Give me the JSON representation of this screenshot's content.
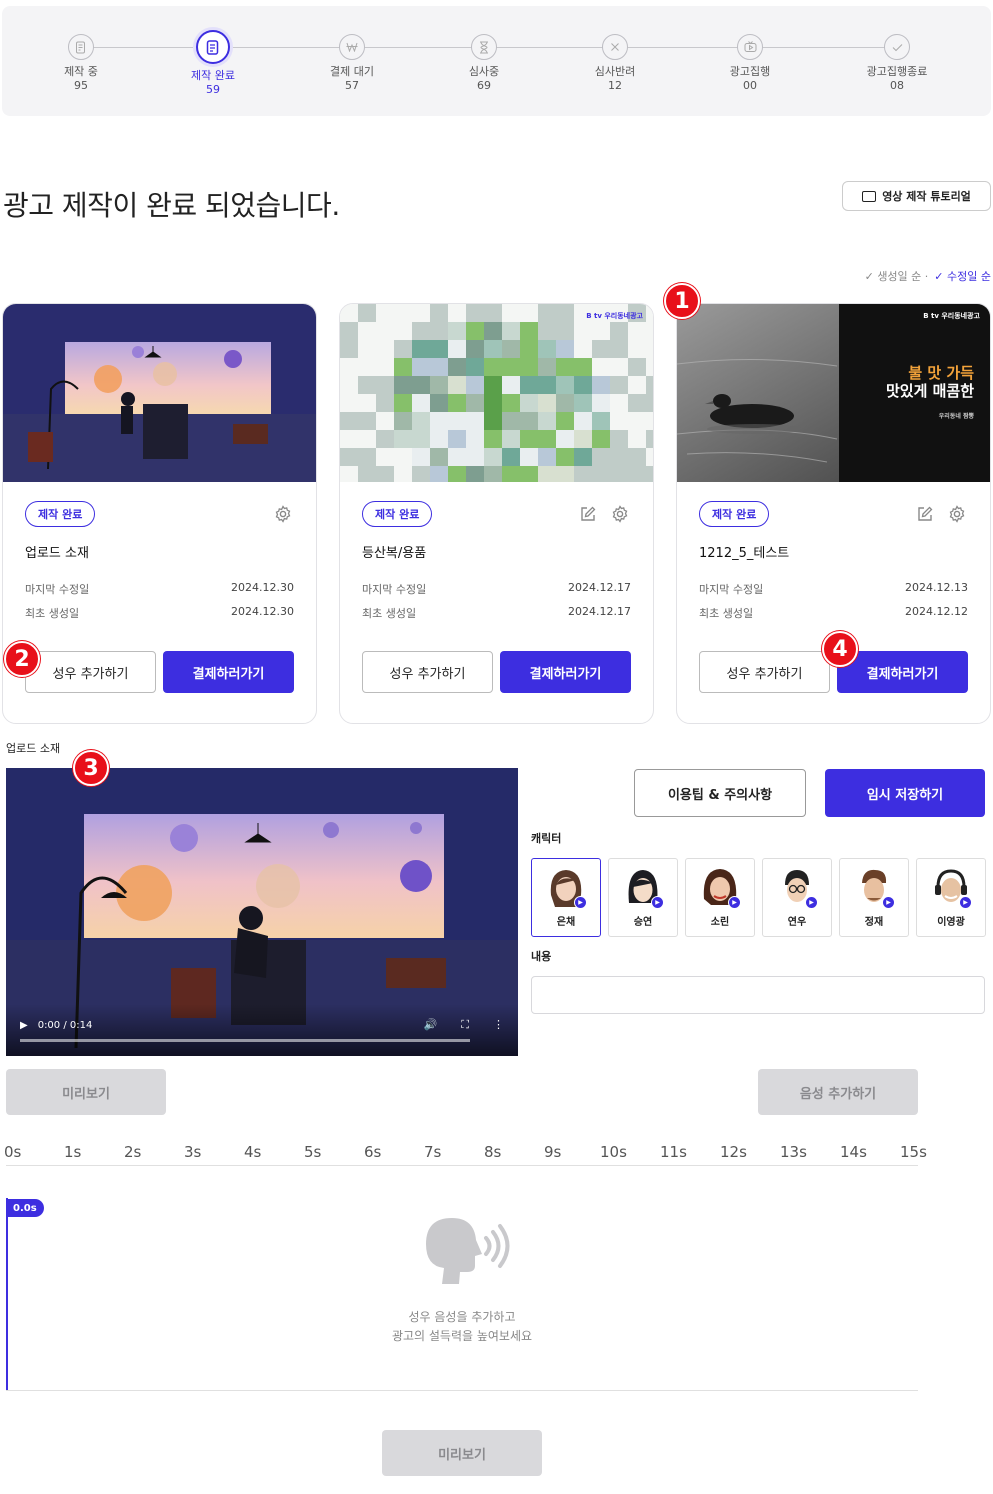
{
  "steps": [
    {
      "label": "제작 중",
      "count": "95",
      "icon": "draft-document-icon"
    },
    {
      "label": "제작 완료",
      "count": "59",
      "icon": "completed-document-icon"
    },
    {
      "label": "결제 대기",
      "count": "57",
      "icon": "won-currency-icon"
    },
    {
      "label": "심사중",
      "count": "69",
      "icon": "hourglass-icon"
    },
    {
      "label": "심사반려",
      "count": "12",
      "icon": "x-circle-icon"
    },
    {
      "label": "광고집행",
      "count": "00",
      "icon": "tv-play-icon"
    },
    {
      "label": "광고집행종료",
      "count": "08",
      "icon": "check-circle-icon"
    }
  ],
  "page_title": "광고 제작이 완료 되었습니다.",
  "tutorial_label": "영상 제작 튜토리얼",
  "sort": {
    "option1": "생성일 순",
    "option2": "수정일 순",
    "active": "수정일 순"
  },
  "cards": [
    {
      "badge": "제작 완료",
      "title": "업로드 소재",
      "modified_label": "마지막 수정일",
      "modified_value": "2024.12.30",
      "created_label": "최초 생성일",
      "created_value": "2024.12.30",
      "voice_button": "성우 추가하기",
      "pay_button": "결제하러가기"
    },
    {
      "badge": "제작 완료",
      "title": "등산복/용품",
      "modified_label": "마지막 수정일",
      "modified_value": "2024.12.17",
      "created_label": "최초 생성일",
      "created_value": "2024.12.17",
      "voice_button": "성우 추가하기",
      "pay_button": "결제하러가기",
      "brand_tag": "B tv 우리동네광고"
    },
    {
      "badge": "제작 완료",
      "title": "1212_5_테스트",
      "modified_label": "마지막 수정일",
      "modified_value": "2024.12.13",
      "created_label": "최초 생성일",
      "created_value": "2024.12.12",
      "voice_button": "성우 추가하기",
      "pay_button": "결제하러가기",
      "brand_tag": "B tv 우리동네광고",
      "overlay_line1": "불 맛 가득",
      "overlay_line2": "맛있게 매콤한",
      "overlay_small": "우리동네 짬뽕"
    }
  ],
  "markers": [
    "1",
    "2",
    "3",
    "4"
  ],
  "editor": {
    "section_label": "업로드 소재",
    "video_time": "0:00 / 0:14",
    "video_progress": 0,
    "tip_button": "이용팁 & 주의사항",
    "save_button": "임시 저장하기",
    "character_label": "캐릭터",
    "characters": [
      {
        "name": "은채",
        "selected": true
      },
      {
        "name": "승연",
        "selected": false
      },
      {
        "name": "소린",
        "selected": false
      },
      {
        "name": "연우",
        "selected": false
      },
      {
        "name": "정재",
        "selected": false
      },
      {
        "name": "이영광",
        "selected": false
      }
    ],
    "content_label": "내용",
    "content_value": "",
    "preview_button": "미리보기",
    "add_voice_button": "음성 추가하기"
  },
  "timeline": {
    "ticks": [
      "0s",
      "1s",
      "2s",
      "3s",
      "4s",
      "5s",
      "6s",
      "7s",
      "8s",
      "9s",
      "10s",
      "11s",
      "12s",
      "13s",
      "14s",
      "15s"
    ],
    "playhead": "0.0s",
    "empty_line1": "성우 음성을 추가하고",
    "empty_line2": "광고의 설득력을 높여보세요",
    "preview_button": "미리보기"
  },
  "colors": {
    "accent": "#3d2ee0",
    "marker": "#e8101a",
    "disabled": "#d9d9dc"
  }
}
